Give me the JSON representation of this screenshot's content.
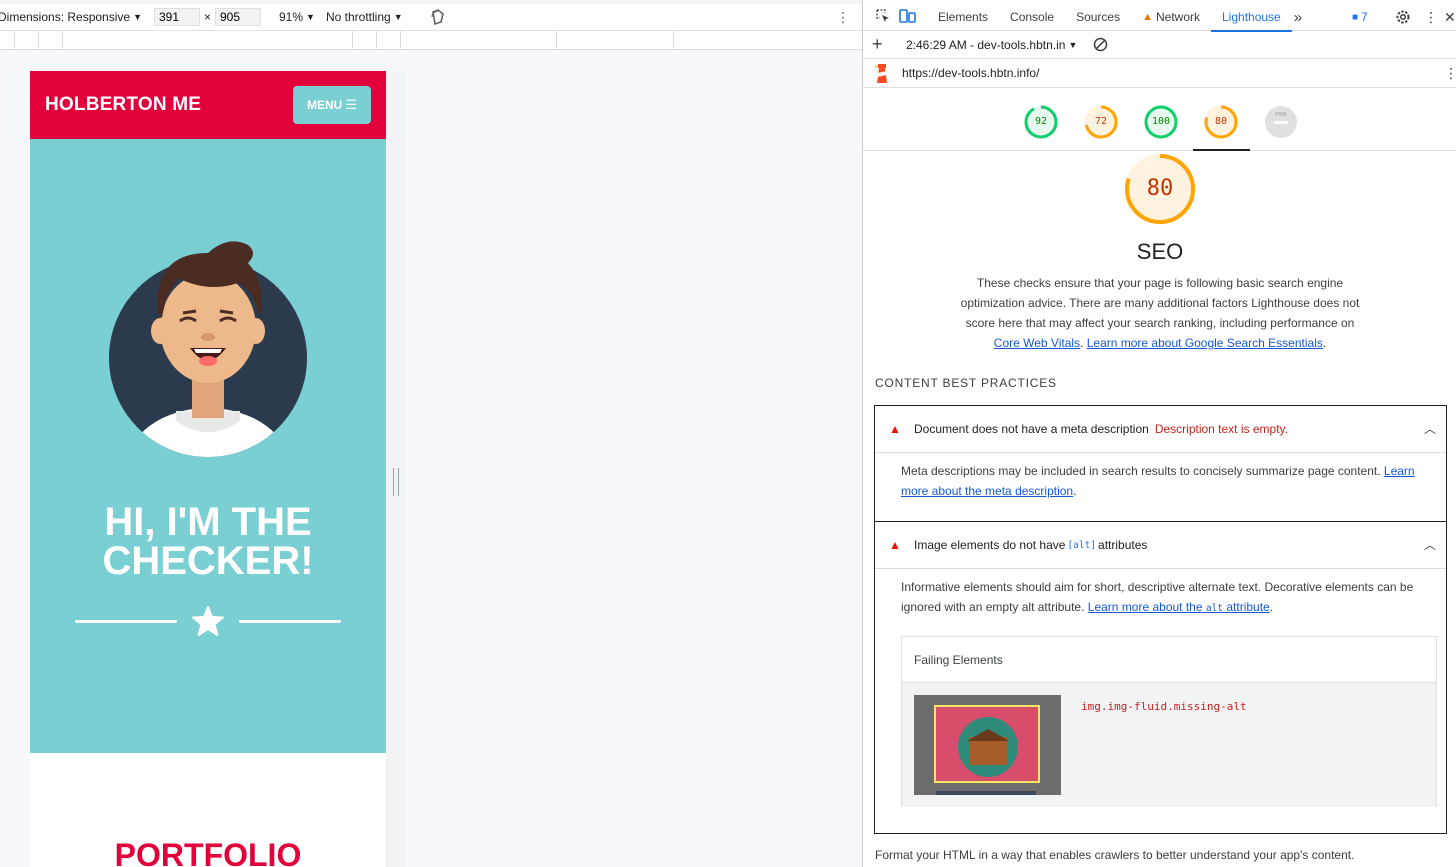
{
  "device_toolbar": {
    "dimensions_label": "Dimensions: Responsive",
    "width_value": "391",
    "times": "×",
    "height_value": "905",
    "zoom": "91%",
    "throttling": "No throttling"
  },
  "site": {
    "brand": "HOLBERTON ME",
    "menu_label": "MENU",
    "hero_title": "HI, I'M THE CHECKER!",
    "section_title": "PORTFOLIO",
    "colors": {
      "primary": "#e2003b",
      "teal": "#7acfd3"
    }
  },
  "devtools": {
    "tabs": [
      {
        "label": "Elements"
      },
      {
        "label": "Console"
      },
      {
        "label": "Sources"
      },
      {
        "label": "Network"
      },
      {
        "label": "Lighthouse"
      }
    ],
    "more_tabs": "»",
    "issues_count": "7",
    "report_selector": "2:46:29 AM - dev-tools.hbtn.in",
    "url": "https://dev-tools.hbtn.info/",
    "scores": [
      {
        "value": "92",
        "status": "pass",
        "color": "#0cce6b"
      },
      {
        "value": "72",
        "status": "average",
        "color": "#ffa400"
      },
      {
        "value": "100",
        "status": "pass",
        "color": "#0cce6b"
      },
      {
        "value": "80",
        "status": "average",
        "color": "#ffa400"
      },
      {
        "value": "PWA",
        "status": "na",
        "color": "#d0d0d0"
      }
    ],
    "category": {
      "score": "80",
      "title": "SEO",
      "description": "These checks ensure that your page is following basic search engine optimization advice. There are many additional factors Lighthouse does not score here that may affect your search ranking, including performance on",
      "link1": "Core Web Vitals",
      "link_sep": ". ",
      "link2": "Learn more about Google Search Essentials",
      "end": "."
    },
    "group_title": "CONTENT BEST PRACTICES",
    "audits": [
      {
        "title": "Document does not have a meta description",
        "error": "Description text is empty.",
        "description": "Meta descriptions may be included in search results to concisely summarize page content. ",
        "link": "Learn more about the meta description",
        "end": "."
      },
      {
        "title_pre": "Image elements do not have ",
        "title_code": "[alt]",
        "title_post": " attributes",
        "description": "Informative elements should aim for short, descriptive alternate text. Decorative elements can be ignored with an empty alt attribute. ",
        "link_pre": "Learn more about the ",
        "link_code": "alt",
        "link_post": " attribute",
        "end": ".",
        "failing_header": "Failing Elements",
        "failing_selector": "img.img-fluid.missing-alt"
      }
    ],
    "footer_text": "Format your HTML in a way that enables crawlers to better understand your app's content."
  }
}
